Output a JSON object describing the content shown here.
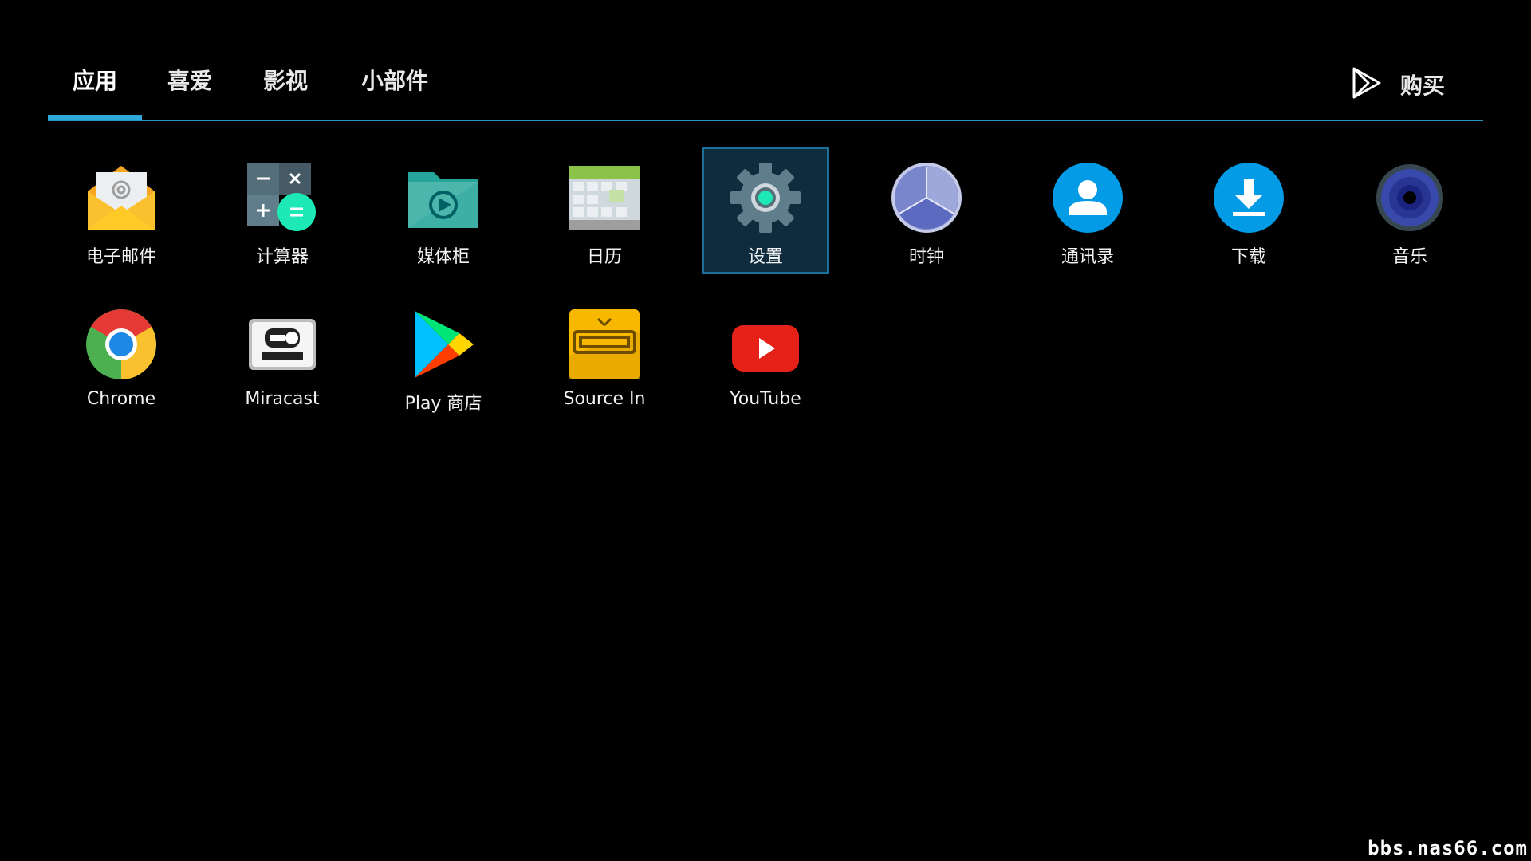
{
  "tabs": [
    {
      "label": "应用",
      "active": true
    },
    {
      "label": "喜爱",
      "active": false
    },
    {
      "label": "影视",
      "active": false
    },
    {
      "label": "小部件",
      "active": false
    }
  ],
  "buy": {
    "label": "购买",
    "icon": "play-store-outline-icon"
  },
  "apps": [
    {
      "label": "电子邮件",
      "icon": "email-icon"
    },
    {
      "label": "计算器",
      "icon": "calculator-icon"
    },
    {
      "label": "媒体柜",
      "icon": "media-folder-icon"
    },
    {
      "label": "日历",
      "icon": "calendar-icon"
    },
    {
      "label": "设置",
      "icon": "settings-gear-icon",
      "focused": true
    },
    {
      "label": "时钟",
      "icon": "clock-icon"
    },
    {
      "label": "通讯录",
      "icon": "contacts-icon"
    },
    {
      "label": "下载",
      "icon": "download-icon"
    },
    {
      "label": "音乐",
      "icon": "music-speaker-icon"
    },
    {
      "label": "Chrome",
      "icon": "chrome-icon"
    },
    {
      "label": "Miracast",
      "icon": "wifi-display-icon"
    },
    {
      "label": "Play 商店",
      "icon": "play-store-icon"
    },
    {
      "label": "Source In",
      "icon": "hdmi-icon"
    },
    {
      "label": "YouTube",
      "icon": "youtube-icon"
    }
  ],
  "watermark": "bbs.nas66.com",
  "colors": {
    "accent": "#2fa8dc",
    "focus_bg": "#0f2b3e",
    "focus_border": "#1c6f9c"
  }
}
